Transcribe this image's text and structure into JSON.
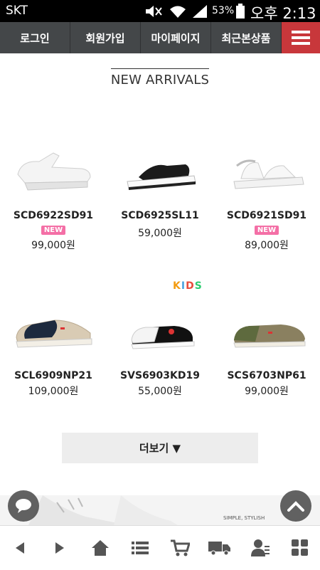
{
  "status_bar": {
    "carrier": "SKT",
    "battery": "53%",
    "time": "오후 2:13"
  },
  "top_nav": {
    "items": [
      "로그인",
      "회원가입",
      "마이페이지",
      "최근본상품"
    ],
    "menu_icon": "hamburger-icon"
  },
  "section": {
    "title": "NEW ARRIVALS"
  },
  "products": [
    {
      "code": "SCD6922SD91",
      "badge": "NEW",
      "price": "99,000원",
      "icon": "white-wedge-sandal"
    },
    {
      "code": "SCD6925SL11",
      "badge": "",
      "price": "59,000원",
      "icon": "black-slide-sandal"
    },
    {
      "code": "SCD6921SD91",
      "badge": "NEW",
      "price": "89,000원",
      "icon": "white-strap-sandal"
    },
    {
      "code": "SCL6909NP21",
      "badge": "",
      "price": "109,000원",
      "icon": "navy-beige-sneaker"
    },
    {
      "code": "SVS6903KD19",
      "badge": "",
      "price": "55,000원",
      "icon": "black-white-slipon"
    },
    {
      "code": "SCS6703NP61",
      "badge": "",
      "price": "99,000원",
      "icon": "olive-slipon"
    }
  ],
  "kids_tag": {
    "letters": [
      "K",
      "I",
      "D",
      "S"
    ],
    "colors": [
      "#f39c12",
      "#4aa3df",
      "#e74c3c",
      "#2ecc71"
    ]
  },
  "more_button": {
    "label": "더보기 ▼"
  },
  "banner": {
    "text": "SIMPLE, STYLISH"
  },
  "fabs": {
    "chat_icon": "chat-icon",
    "top_icon": "chevron-up-icon"
  },
  "bottom_bar": {
    "icons": [
      "back-arrow-icon",
      "forward-arrow-icon",
      "home-icon",
      "list-icon",
      "cart-icon",
      "delivery-truck-icon",
      "user-icon",
      "grid-icon"
    ]
  },
  "colors": {
    "nav_bg": "#444749",
    "menu_red": "#c8373b",
    "badge_pink": "#f46fa6",
    "icon_gray": "#555555"
  }
}
